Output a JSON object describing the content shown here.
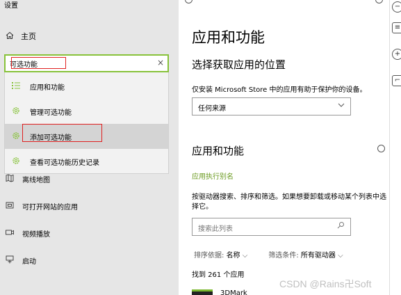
{
  "window": {
    "title": "设置"
  },
  "nav": {
    "home": "主页",
    "items": [
      {
        "label": "离线地图",
        "icon": "map-icon"
      },
      {
        "label": "可打开网站的应用",
        "icon": "web-app-icon"
      },
      {
        "label": "视频播放",
        "icon": "video-icon"
      },
      {
        "label": "启动",
        "icon": "startup-icon"
      }
    ]
  },
  "search": {
    "value": "可选功能",
    "clear": "×",
    "suggestions": [
      {
        "label": "应用和功能",
        "icon": "list-icon"
      },
      {
        "label": "管理可选功能",
        "icon": "gear-icon"
      },
      {
        "label": "添加可选功能",
        "icon": "gear-icon"
      },
      {
        "label": "查看可选功能历史记录",
        "icon": "gear-icon"
      }
    ]
  },
  "main": {
    "title": "应用和功能",
    "section1_title": "选择获取应用的位置",
    "section1_desc": "仅安装 Microsoft Store 中的应用有助于保护你的设备。",
    "source_dropdown": "任何来源",
    "section2_title": "应用和功能",
    "alias_link": "应用执行别名",
    "section2_desc": "按驱动器搜索、排序和筛选。如果想要卸载或移动某个列表中选择它。",
    "list_search_placeholder": "搜索此列表",
    "sort_label": "排序依据:",
    "sort_value": "名称",
    "filter_label": "筛选条件:",
    "filter_value": "所有驱动器",
    "found": "找到 261 个应用",
    "first_app": "3DMark"
  },
  "watermark": "CSDN @Rains卍Soft",
  "colors": {
    "accent": "#87c239",
    "highlight": "#e02020",
    "link": "#6a9a1f"
  }
}
